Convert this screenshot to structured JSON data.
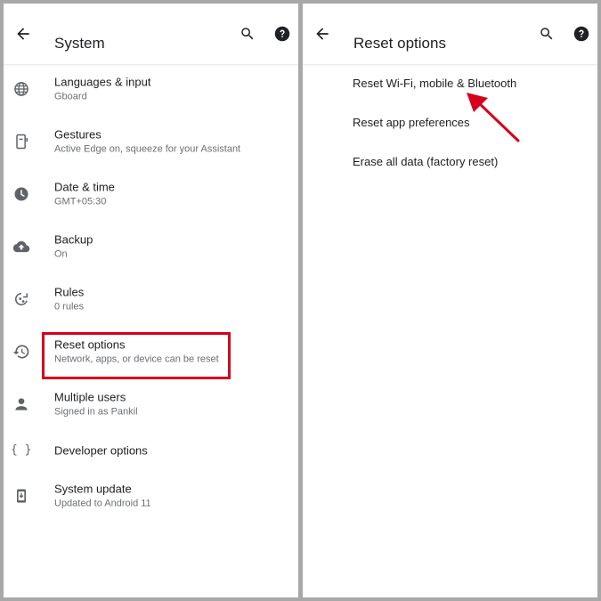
{
  "left": {
    "title": "System",
    "items": [
      {
        "icon": "globe-icon",
        "label": "Languages & input",
        "sub": "Gboard"
      },
      {
        "icon": "gestures-icon",
        "label": "Gestures",
        "sub": "Active Edge on, squeeze for your Assistant"
      },
      {
        "icon": "clock-icon",
        "label": "Date & time",
        "sub": "GMT+05:30"
      },
      {
        "icon": "cloud-upload-icon",
        "label": "Backup",
        "sub": "On"
      },
      {
        "icon": "rules-icon",
        "label": "Rules",
        "sub": "0 rules"
      },
      {
        "icon": "history-icon",
        "label": "Reset options",
        "sub": "Network, apps, or device can be reset"
      },
      {
        "icon": "person-icon",
        "label": "Multiple users",
        "sub": "Signed in as Pankil"
      },
      {
        "icon": "braces-icon",
        "label": "Developer options",
        "sub": ""
      },
      {
        "icon": "system-update-icon",
        "label": "System update",
        "sub": "Updated to Android 11"
      }
    ],
    "icons": {
      "braces": "{ }"
    }
  },
  "right": {
    "title": "Reset options",
    "items": [
      {
        "label": "Reset Wi-Fi, mobile & Bluetooth"
      },
      {
        "label": "Reset app preferences"
      },
      {
        "label": "Erase all data (factory reset)"
      }
    ]
  },
  "colors": {
    "highlight": "#d6001c",
    "arrow": "#d6001c",
    "background": "#a8a8a8"
  }
}
